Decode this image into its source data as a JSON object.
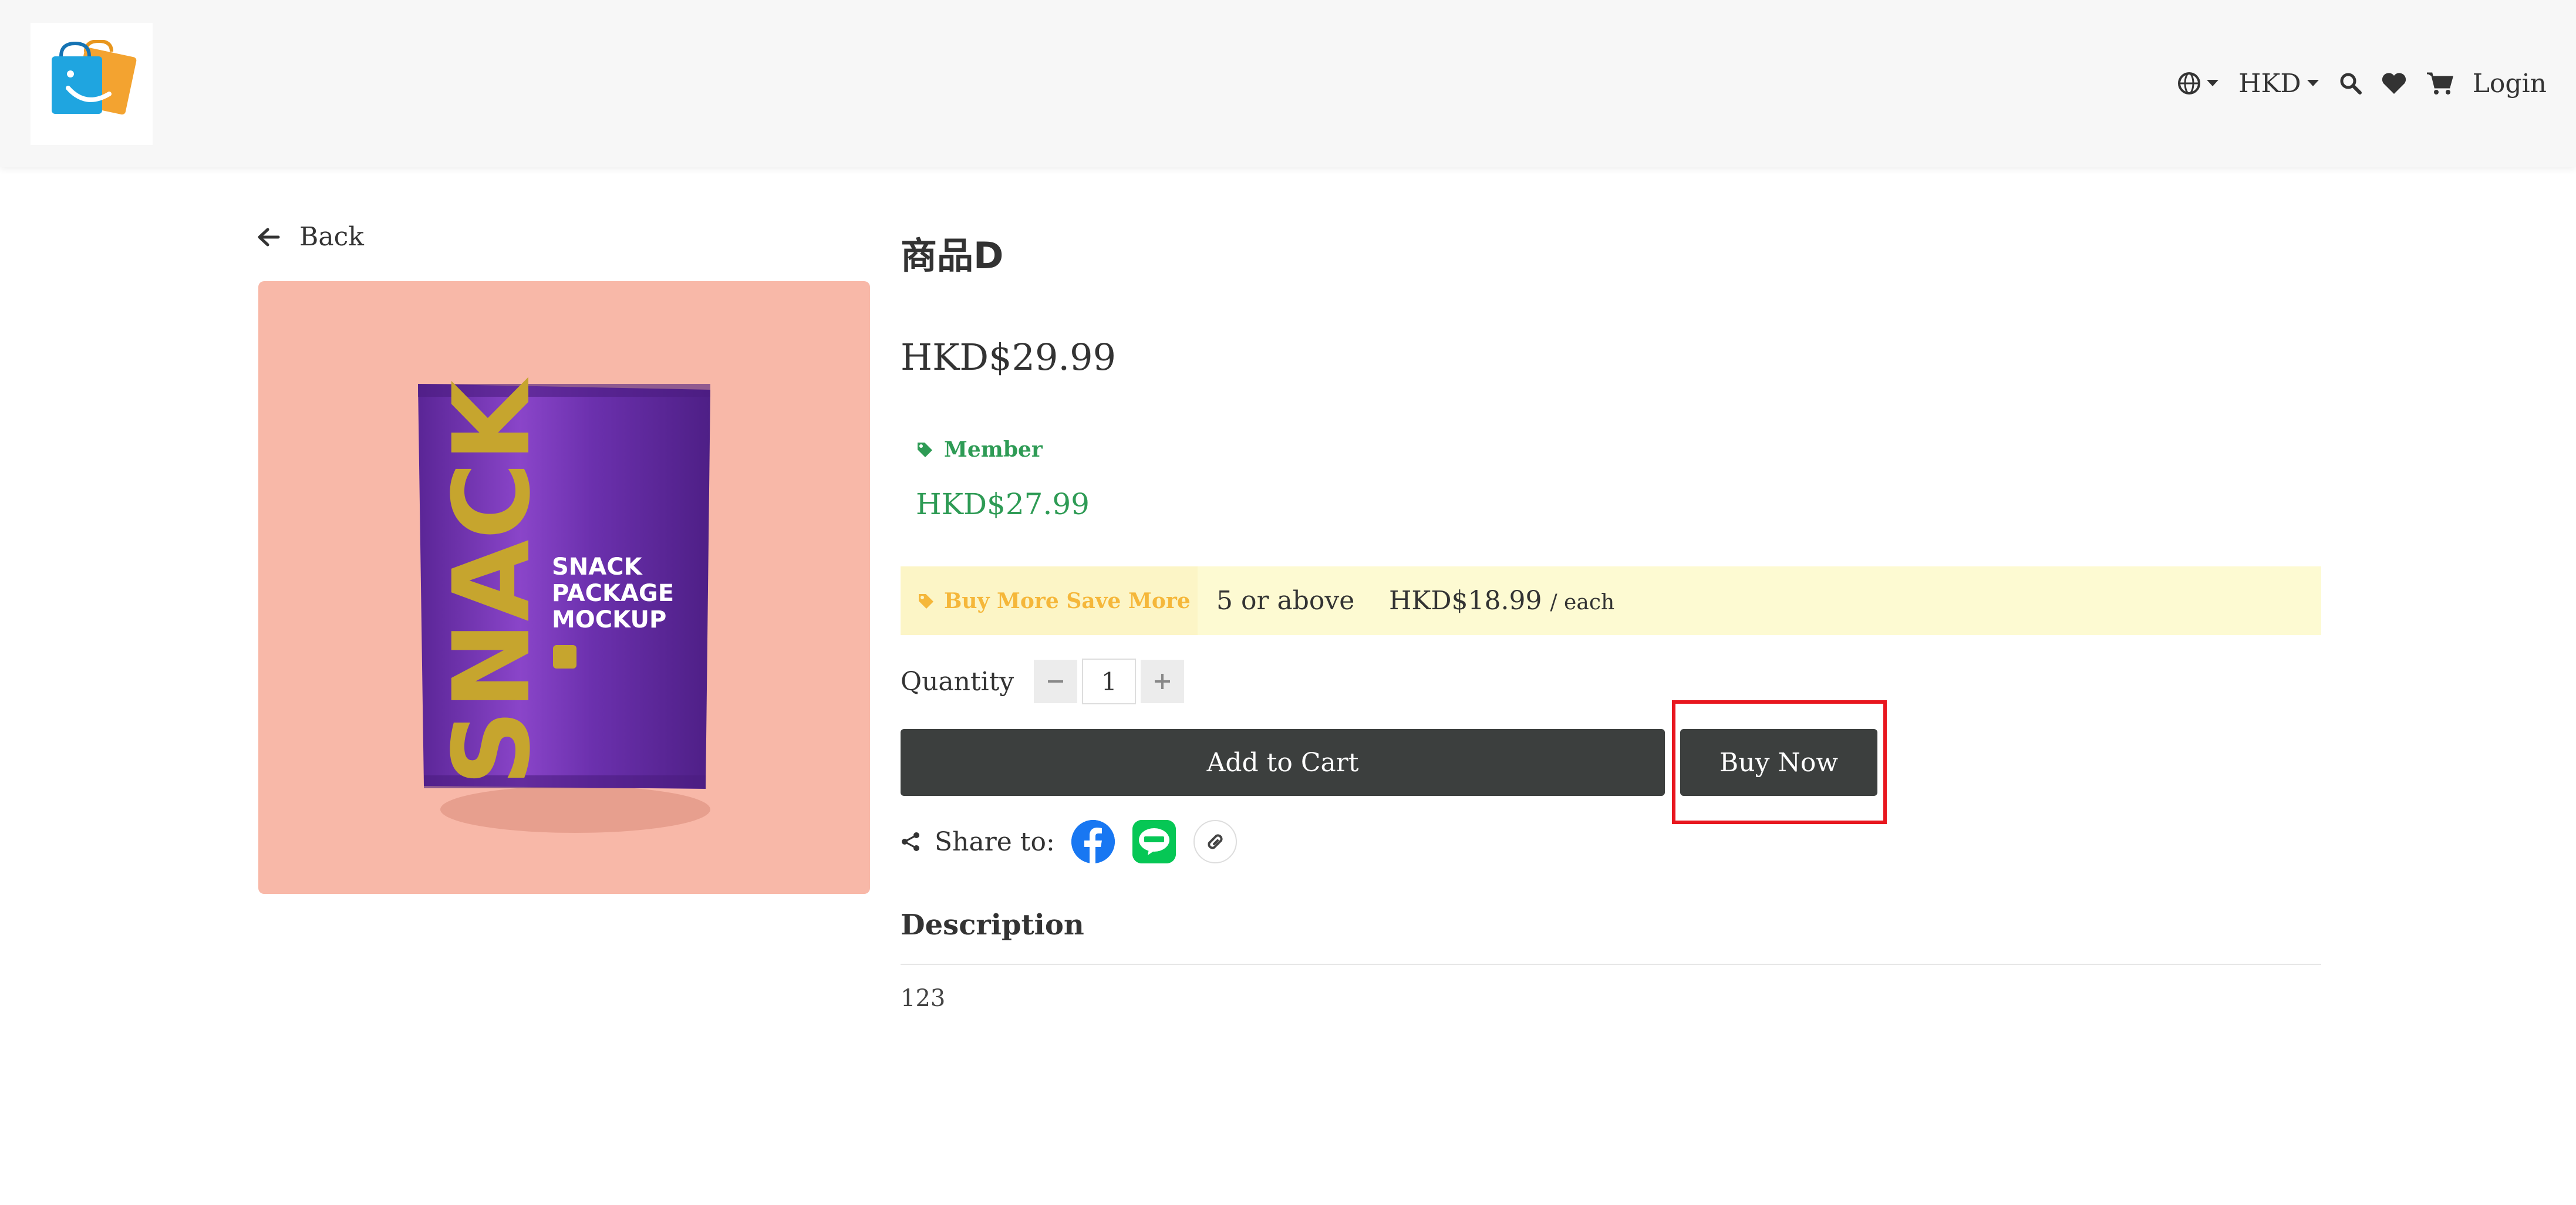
{
  "header": {
    "language_icon": "globe-icon",
    "currency": "HKD",
    "login_label": "Login"
  },
  "nav": {
    "back_label": "Back"
  },
  "product": {
    "title": "商品D",
    "price": "HKD$29.99",
    "member_label": "Member",
    "member_price": "HKD$27.99",
    "bulk_label": "Buy More Save More",
    "bulk_qty": "5 or above",
    "bulk_price": "HKD$18.99",
    "bulk_unit": "/ each",
    "image_text": {
      "line1": "SNACK",
      "line2": "PACKAGE",
      "line3": "MOCKUP",
      "brand": "SNACK"
    }
  },
  "quantity": {
    "label": "Quantity",
    "value": "1"
  },
  "actions": {
    "add_to_cart": "Add to Cart",
    "buy_now": "Buy Now"
  },
  "share": {
    "label": "Share to:"
  },
  "description": {
    "title": "Description",
    "body": "123"
  },
  "colors": {
    "accent_green": "#2e9b55",
    "bulk_bg": "#fdfad2",
    "button_dark": "#3c3f3e",
    "highlight_red": "#e8171f",
    "image_bg": "#f8b8a8"
  }
}
